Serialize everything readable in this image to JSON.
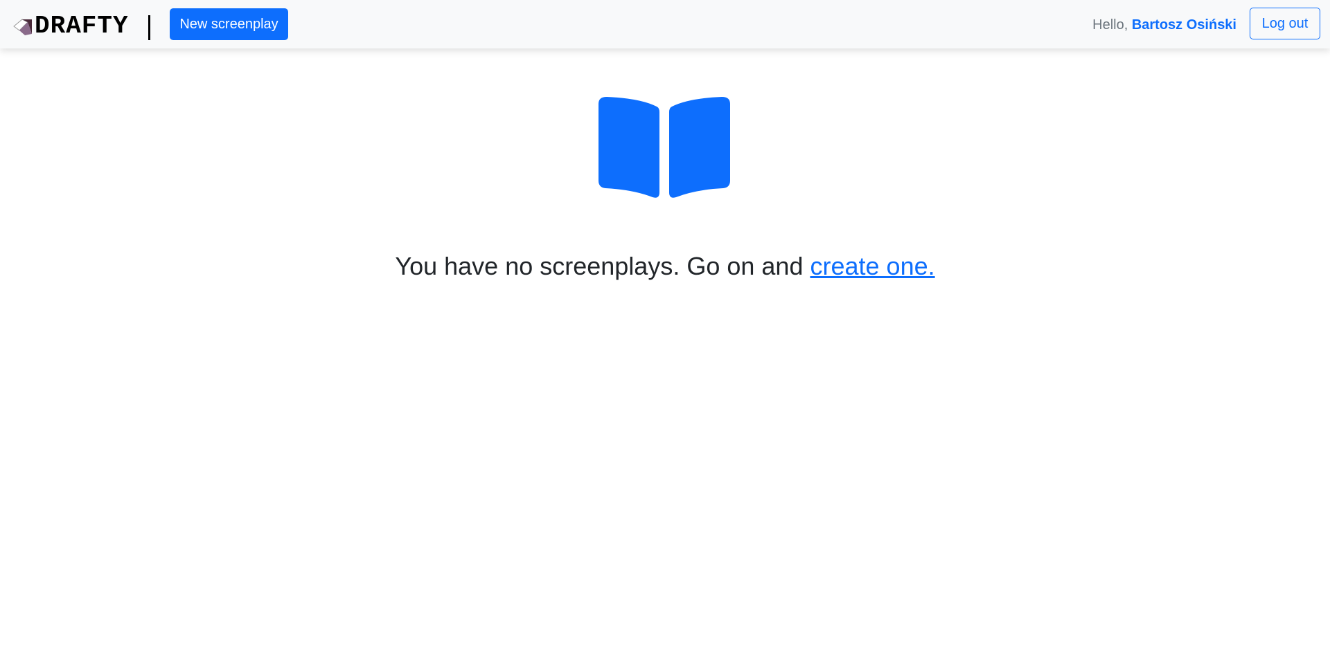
{
  "navbar": {
    "brand": "DRAFTY",
    "new_button_label": "New screenplay",
    "greeting_prefix": "Hello,",
    "user_name": "Bartosz Osiński",
    "logout_label": "Log out"
  },
  "main": {
    "icon": "book-icon",
    "empty_message": "You have no screenplays. Go on and",
    "create_link_label": "create one."
  },
  "colors": {
    "primary": "#0d6efd",
    "navbar_bg": "#f8f9fa",
    "text": "#212529",
    "muted": "#6c757d"
  }
}
